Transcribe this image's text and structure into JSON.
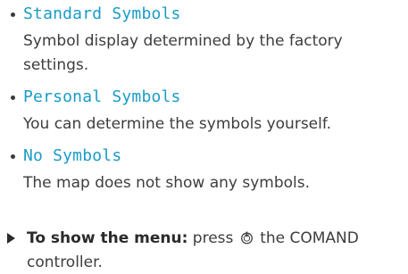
{
  "options": [
    {
      "name": "Standard Symbols",
      "description_line1": "Symbol display determined by the factory",
      "description_line2": "settings."
    },
    {
      "name": "Personal Symbols",
      "description_line1": "You can determine the symbols yourself."
    },
    {
      "name": "No Symbols",
      "description_line1": "The map does not show any symbols."
    }
  ],
  "instruction": {
    "bold_label": "To show the menu:",
    "text_before_icon": "press",
    "icon": "controller-press-icon",
    "text_after_icon": "the COMAND",
    "line2": "controller."
  },
  "colors": {
    "option_name": "#1a9bc7",
    "body_text": "#3d3d3d"
  }
}
